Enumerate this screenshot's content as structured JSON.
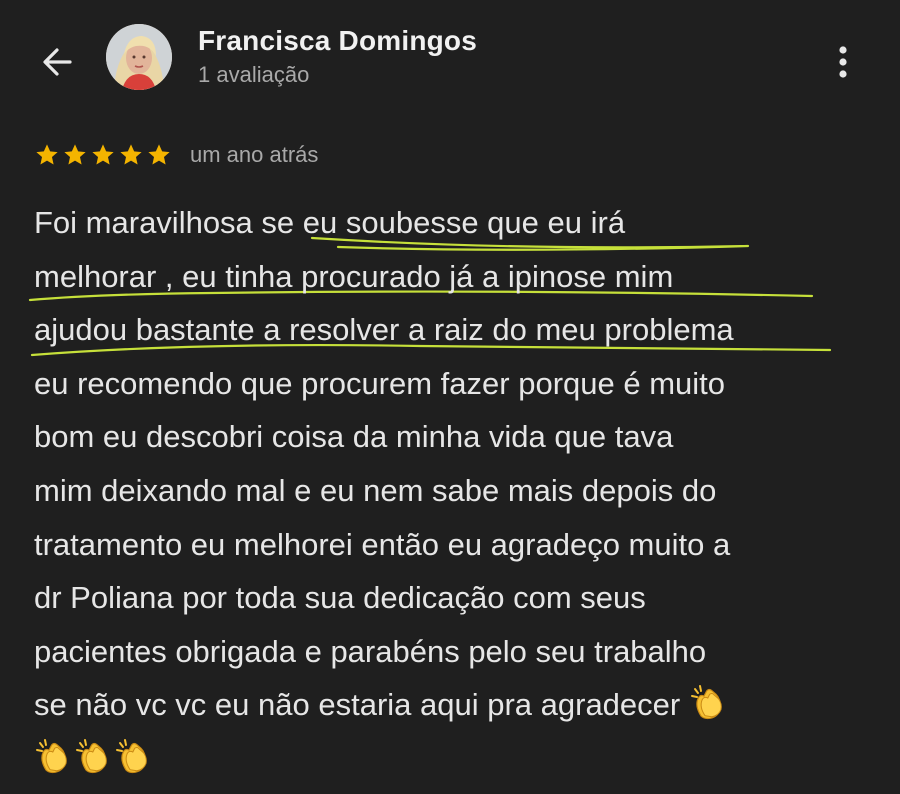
{
  "header": {
    "back_icon": "arrow-left-icon",
    "user_name": "Francisca Domingos",
    "user_meta": "1 avaliação",
    "more_icon": "more-vert-icon"
  },
  "rating": {
    "stars": 5,
    "timestamp": "um ano atrás",
    "star_color": "#f4b400"
  },
  "review": {
    "lines": [
      "Foi maravilhosa se eu soubesse que eu irá",
      "melhorar , eu tinha procurado já a ipinose mim",
      "ajudou bastante a resolver a raiz do meu problema",
      "eu recomendo que procurem fazer porque é muito",
      "bom eu descobri coisa da minha vida que tava",
      "mim deixando mal e eu nem sabe mais depois do",
      "tratamento eu melhorei então eu agradeço muito a",
      "dr Poliana por toda sua dedicação com seus",
      "pacientes obrigada e parabéns pelo seu trabalho",
      "se não vc vc eu não estaria aqui pra agradecer"
    ],
    "emoji_icon": "clapping-hands-icon",
    "highlight_color": "#c6e03a"
  }
}
